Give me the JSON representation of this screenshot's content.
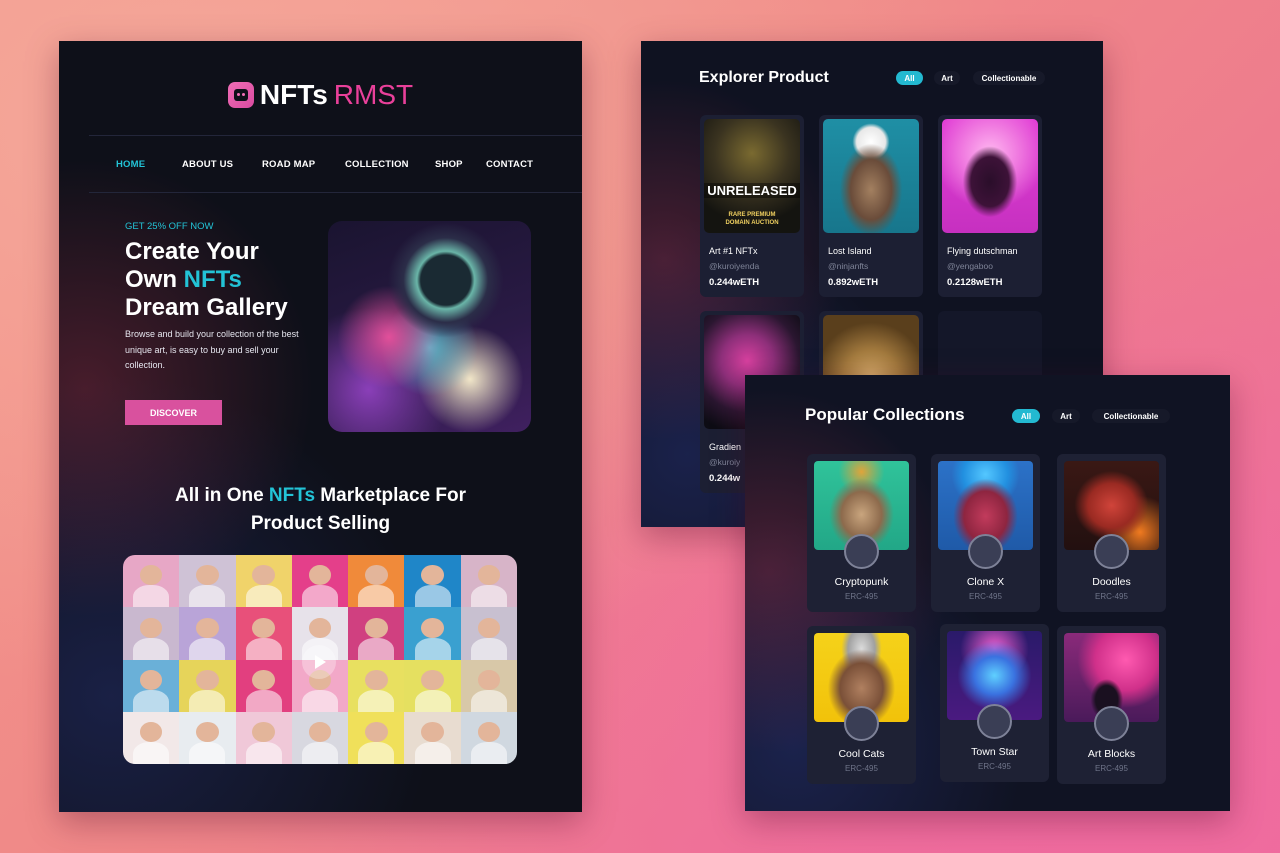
{
  "landing": {
    "logo": {
      "part1": "NFTs",
      "part2": "RMST"
    },
    "nav": [
      "HOME",
      "ABOUT US",
      "ROAD MAP",
      "COLLECTION",
      "SHOP",
      "CONTACT"
    ],
    "hero": {
      "sub": "GET 25% OFF NOW",
      "title_line1": "Create Your",
      "title_line2_a": "Own ",
      "title_line2_b": "NFTs",
      "title_line3": "Dream Gallery",
      "description": "Browse and build your collection of the best unique art, is easy to buy and sell your collection.",
      "button": "DISCOVER"
    },
    "section": {
      "line1_a": "All in One ",
      "line1_b": "NFTs",
      "line1_c": " Marketplace For",
      "line2": "Product Selling"
    }
  },
  "explorer": {
    "title": "Explorer Product",
    "filters": [
      "All",
      "Art",
      "Collectionable"
    ],
    "cards": [
      {
        "name": "Art #1 NFTx",
        "user": "@kuroiyenda",
        "price": "0.244wETH",
        "overlay": "UNRELEASED",
        "overlay_sub": "RARE PREMIUM DOMAIN AUCTION"
      },
      {
        "name": "Lost Island",
        "user": "@ninjanfts",
        "price": "0.892wETH"
      },
      {
        "name": "Flying dutschman",
        "user": "@yengaboo",
        "price": "0.2128wETH"
      },
      {
        "name": "Gradien",
        "user": "@kuroiy",
        "price": "0.244w"
      },
      {
        "name": "",
        "user": "",
        "price": ""
      }
    ]
  },
  "popular": {
    "title": "Popular Collections",
    "filters": [
      "All",
      "Art",
      "Collectionable"
    ],
    "collections": [
      {
        "name": "Cryptopunk",
        "standard": "ERC-495"
      },
      {
        "name": "Clone X",
        "standard": "ERC-495"
      },
      {
        "name": "Doodles",
        "standard": "ERC-495"
      },
      {
        "name": "Cool Cats",
        "standard": "ERC-495"
      },
      {
        "name": "Town Star",
        "standard": "ERC-495"
      },
      {
        "name": "Art Blocks",
        "standard": "ERC-495"
      }
    ]
  },
  "colors": {
    "accent": "#23c3d6",
    "brand_pink": "#e9409a",
    "button": "#d9519e",
    "panel": "#0e1019"
  }
}
